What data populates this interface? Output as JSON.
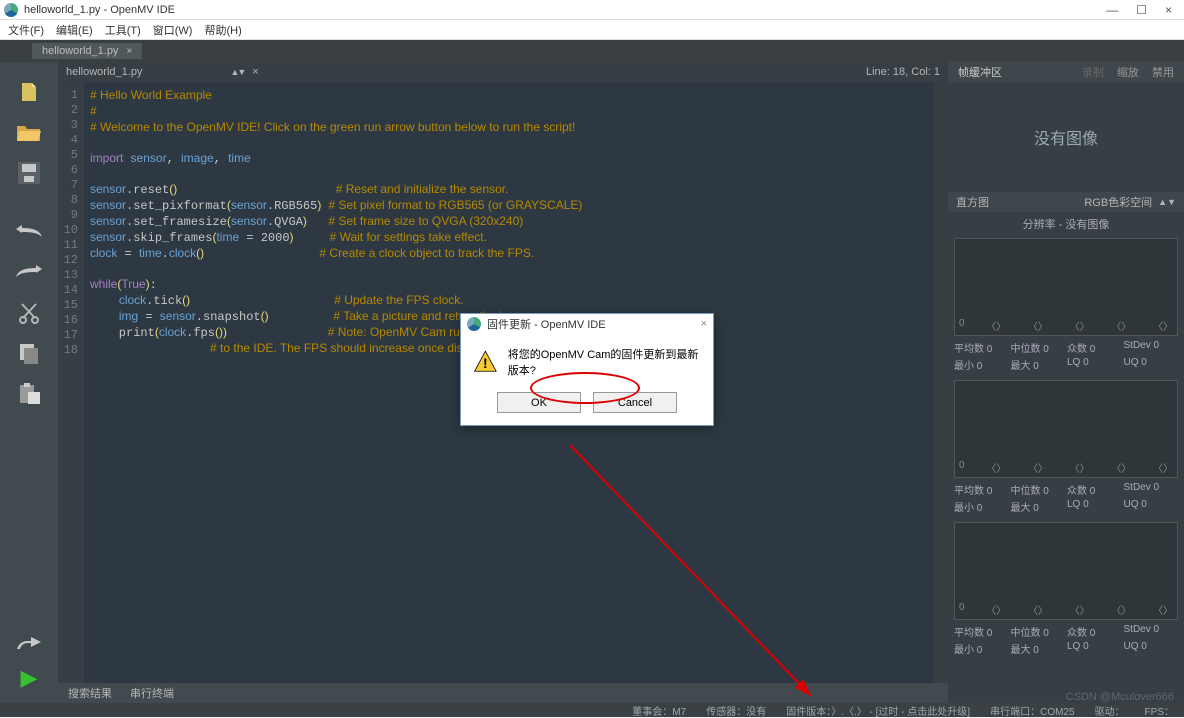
{
  "window": {
    "title": "helloworld_1.py - OpenMV IDE",
    "min": "—",
    "max": "☐",
    "close": "×"
  },
  "menu": {
    "file": "文件(F)",
    "edit": "编辑(E)",
    "tool": "工具(T)",
    "window": "窗口(W)",
    "help": "帮助(H)"
  },
  "tab": {
    "name": "helloworld_1.py",
    "close": "×"
  },
  "file_header": {
    "filename": "helloworld_1.py",
    "close": "×",
    "line_col": "Line: 18, Col: 1"
  },
  "code_lines": [
    "# Hello World Example",
    "#",
    "# Welcome to the OpenMV IDE! Click on the green run arrow button below to run the script!",
    "",
    "import sensor, image, time",
    "",
    "sensor.reset()                      # Reset and initialize the sensor.",
    "sensor.set_pixformat(sensor.RGB565) # Set pixel format to RGB565 (or GRAYSCALE)",
    "sensor.set_framesize(sensor.QVGA)   # Set frame size to QVGA (320x240)",
    "sensor.skip_frames(time = 2000)     # Wait for settings take effect.",
    "clock = time.clock()                # Create a clock object to track the FPS.",
    "",
    "while(True):",
    "    clock.tick()                    # Update the FPS clock.",
    "    img = sensor.snapshot()         # Take a picture and return the image.",
    "    print(clock.fps())              # Note: OpenMV Cam runs about half as fast when connected",
    "                                    # to the IDE. The FPS should increase once disconnected.",
    ""
  ],
  "line_numbers": [
    "1",
    "2",
    "3",
    "4",
    "5",
    "6",
    "7",
    "8",
    "9",
    "10",
    "11",
    "12",
    "13",
    "14",
    "15",
    "16",
    "17",
    "18"
  ],
  "right": {
    "buffer": {
      "label": "帧缓冲区",
      "zoom": "缩放",
      "disable": "禁用"
    },
    "no_image": "没有图像",
    "hist_label": "直方图",
    "colorspace": "RGB色彩空间",
    "resolution": "分辨率 - 没有图像",
    "hist_x_ticks": [
      "0",
      "〈〉",
      "〈〉",
      "〈〉",
      "〈〉",
      "〈〉"
    ],
    "stats": {
      "mean": "平均数",
      "median": "中位数",
      "mode": "众数",
      "stdev": "StDev",
      "min": "最小",
      "max": "最大",
      "lq": "LQ",
      "uq": "UQ"
    },
    "val0": "0"
  },
  "bottom_tabs": {
    "search": "搜索结果",
    "serial": "串行终端"
  },
  "status": {
    "board": "董事会：M7",
    "sensor": "传感器：没有",
    "firmware": "固件版本：〉.〈.〉 - [过时 - 点击此处升级]",
    "port": "串行端口：COM25",
    "drive": "驱动：",
    "fps": "FPS："
  },
  "dialog": {
    "title": "固件更新 - OpenMV IDE",
    "message": "将您的OpenMV Cam的固件更新到最新版本?",
    "ok": "OK",
    "cancel": "Cancel",
    "close": "×"
  },
  "watermark": "CSDN @Mculover666"
}
